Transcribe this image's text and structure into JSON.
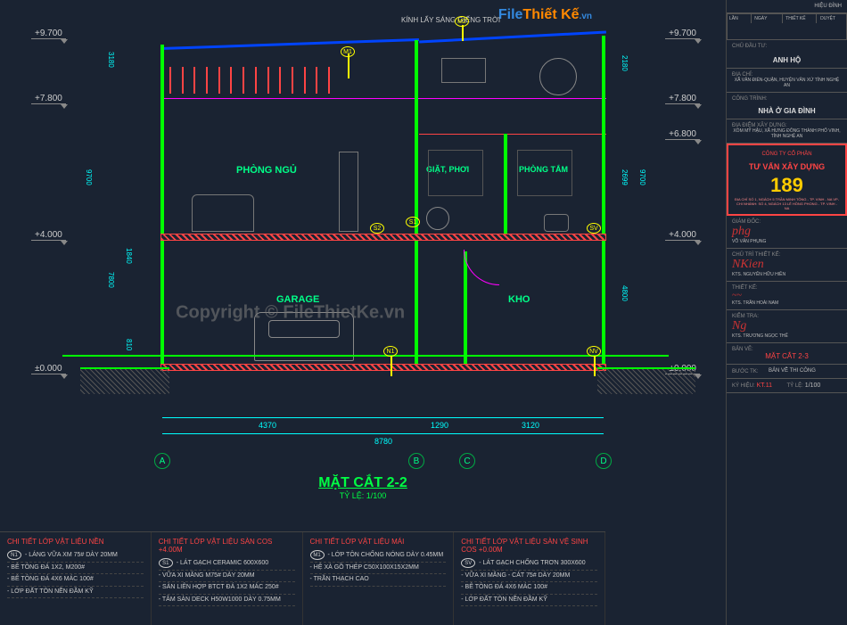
{
  "logo": {
    "file": "File",
    "thiet": "Thiết Kế",
    "vn": ".vn"
  },
  "elevations": {
    "l1": "+9.700",
    "l2": "+7.800",
    "l3": "+4.000",
    "l4": "±0.000",
    "r1": "+9.700",
    "r2": "+7.800",
    "r3": "+6.800",
    "r4": "+4.000",
    "r5": "±0.000"
  },
  "skylight": "KÍNH LẤY SÁNG GIẾNG TRỜI",
  "rooms": {
    "bedroom": "PHÒNG NGỦ",
    "laundry": "GIẶT, PHƠI",
    "bathroom": "PHÒNG TẮM",
    "garage": "GARAGE",
    "storage": "KHO"
  },
  "callouts": {
    "m1": "M1",
    "m2": "M2",
    "n1": "N1",
    "nv": "NV",
    "s1": "S1",
    "s2": "S2",
    "sv": "SV"
  },
  "grids": {
    "a": "A",
    "b": "B",
    "c": "C",
    "d": "D"
  },
  "dims": {
    "d1": "4370",
    "d2": "1290",
    "d3": "3120",
    "total": "8780",
    "v_top": "3180",
    "v_mid": "9700",
    "v_b1": "7800",
    "v_b2": "1840",
    "v_b3": "810",
    "v_r1": "2180",
    "v_r2": "2699",
    "v_r3": "9700",
    "v_r4": "4800"
  },
  "title": {
    "name": "MẶT CẮT 2-2",
    "scale": "TỶ LỆ: 1/100"
  },
  "copyright": "Copyright © FileThietKe.vn",
  "notes": {
    "col1": {
      "title": "CHI TIẾT LỚP VẬT LIỆU NỀN",
      "tag": "N1",
      "items": [
        "LÁNG VỮA XM 75# DÀY 20MM",
        "BÊ TÔNG ĐÁ 1X2, M200#",
        "BÊ TÔNG ĐÁ 4X6 MÁC 100#",
        "LỚP ĐẤT TÔN NỀN ĐẦM KỸ"
      ]
    },
    "col2": {
      "title": "CHI TIẾT LỚP VẬT LIỆU SÀN COS +4.00M",
      "tag": "S1",
      "items": [
        "LÁT GẠCH CERAMIC 600X600",
        "VỮA XI MĂNG M75# DÀY 20MM",
        "SÀN LIÊN HỢP BTCT ĐÁ 1X2 MÁC 250#",
        "TÂM SÀN DECK H50W1000 DÀY 0.75MM"
      ]
    },
    "col3": {
      "title": "CHI TIẾT LỚP VẬT LIỆU MÁI",
      "tag": "M1",
      "items": [
        "LỚP TÔN CHỐNG NÓNG DÀY 0.45MM",
        "HỆ XÀ GỒ THÉP C50X100X15X2MM",
        "TRẦN THẠCH CAO"
      ]
    },
    "col4": {
      "title": "CHI TIẾT LỚP VẬT LIỆU SÀN VỆ SINH COS +0.00M",
      "tag": "SV",
      "items": [
        "LÁT GẠCH CHỐNG TRƠN 300X600",
        "VỮA XI MĂNG - CÁT 75# DÀY 20MM",
        "BÊ TÔNG ĐÁ 4X6 MÁC 100#",
        "LỚP ĐẤT TÔN NỀN ĐẦM KỸ"
      ]
    }
  },
  "titleblock": {
    "header": {
      "c1": "LẦN",
      "c2": "NGÀY",
      "c3": "THIẾT KẾ",
      "c4": "DUYỆT"
    },
    "revision": "HIỆU ĐÍNH",
    "client_label": "CHỦ ĐẦU TƯ:",
    "client": "ANH HỘ",
    "address_label": "ĐỊA CHỈ:",
    "address": "XÃ VĂN ĐIỂN-QUẬN, HUYỆN VĂN XỨ TỈNH NGHỆ AN",
    "project_label": "CÔNG TRÌNH:",
    "project": "NHÀ Ở GIA ĐÌNH",
    "site_label": "ĐỊA ĐIỂM XÂY DỰNG:",
    "site": "XÓM MỸ HẬU, XÃ HƯNG ĐÔNG THÀNH PHỐ VINH, TỈNH NGHỆ AN",
    "company_label": "CÔNG TY CỔ PHẦN",
    "company": "TƯ VẤN XÂY DỰNG",
    "company_num": "189",
    "company_addr": "ĐỊA CHỈ SỐ 1, NGÁCH 5 TRẦN MINH TÔNG - TP. VINH - NA VP-CHI NHÁNH: SỐ 4, NGÁCH 13 LÊ HỒNG PHONG - TP. VINH - NA",
    "director_label": "GIÁM ĐỐC:",
    "director": "VÕ VĂN PHỤNG",
    "designer_label": "CHỦ TRÌ THIẾT KẾ:",
    "designer": "KTS. NGUYỄN HỮU HIỀN",
    "engineer_label": "THIẾT KẾ:",
    "engineer": "KTS. TRẦN HOÀI NAM",
    "checker_label": "KIỂM TRA:",
    "checker": "KTS. TRƯƠNG NGỌC THẾ",
    "drawing_label": "BẢN VẼ:",
    "drawing_name": "MẶT CẮT 2-3",
    "stage_label": "BƯỚC TK:",
    "stage": "BẢN VỄ THI CÔNG",
    "sheet_label": "KÝ HIỆU:",
    "sheet": "KT.11",
    "scale_label": "TỶ LỆ:",
    "scale": "1/100"
  }
}
